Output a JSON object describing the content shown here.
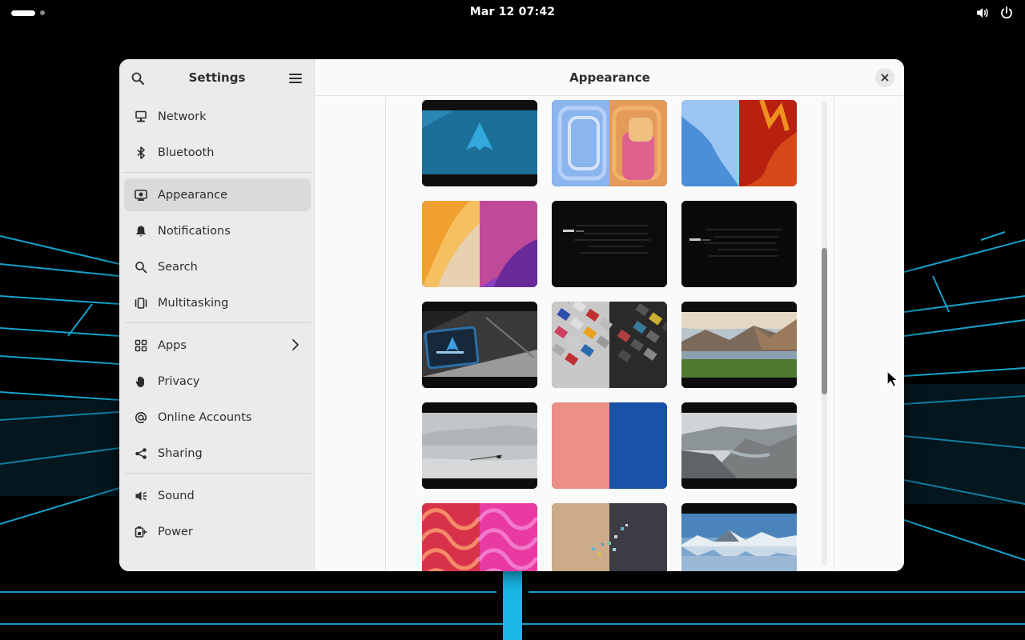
{
  "topbar": {
    "clock": "Mar 12  07:42",
    "tray_icons": [
      "volume-icon",
      "power-icon"
    ]
  },
  "sidebar": {
    "title": "Settings",
    "items": [
      {
        "label": "Network",
        "icon": "network-icon"
      },
      {
        "label": "Bluetooth",
        "icon": "bluetooth-icon"
      },
      {
        "label": "Appearance",
        "icon": "appearance-icon",
        "active": true
      },
      {
        "label": "Notifications",
        "icon": "bell-icon"
      },
      {
        "label": "Search",
        "icon": "search-icon"
      },
      {
        "label": "Multitasking",
        "icon": "multitasking-icon"
      },
      {
        "label": "Apps",
        "icon": "apps-grid-icon",
        "has_submenu": true
      },
      {
        "label": "Privacy",
        "icon": "hand-icon"
      },
      {
        "label": "Online Accounts",
        "icon": "at-icon"
      },
      {
        "label": "Sharing",
        "icon": "share-icon"
      },
      {
        "label": "Sound",
        "icon": "speaker-icon"
      },
      {
        "label": "Power",
        "icon": "battery-plug-icon"
      }
    ]
  },
  "content": {
    "title": "Appearance",
    "wallpapers": [
      "arch-blue-logo",
      "rainbow-spiral",
      "wave-blue-orange",
      "amber-purple-folds",
      "archlinux-glitch-light",
      "archlinux-glitch-dark",
      "archlinux-laptop-snow",
      "keyboard-keys",
      "mountain-lake",
      "foggy-snowfield",
      "pink-blue-texture",
      "fjord-cliffs",
      "pink-red-pattern",
      "sand-dark-dots",
      "mountain-reflection"
    ]
  },
  "colors": {
    "accent_wallpaper": "#19b8e6",
    "sidebar_bg": "#ebebeb",
    "active_item_bg": "#dadada",
    "window_bg": "#fafafa"
  }
}
